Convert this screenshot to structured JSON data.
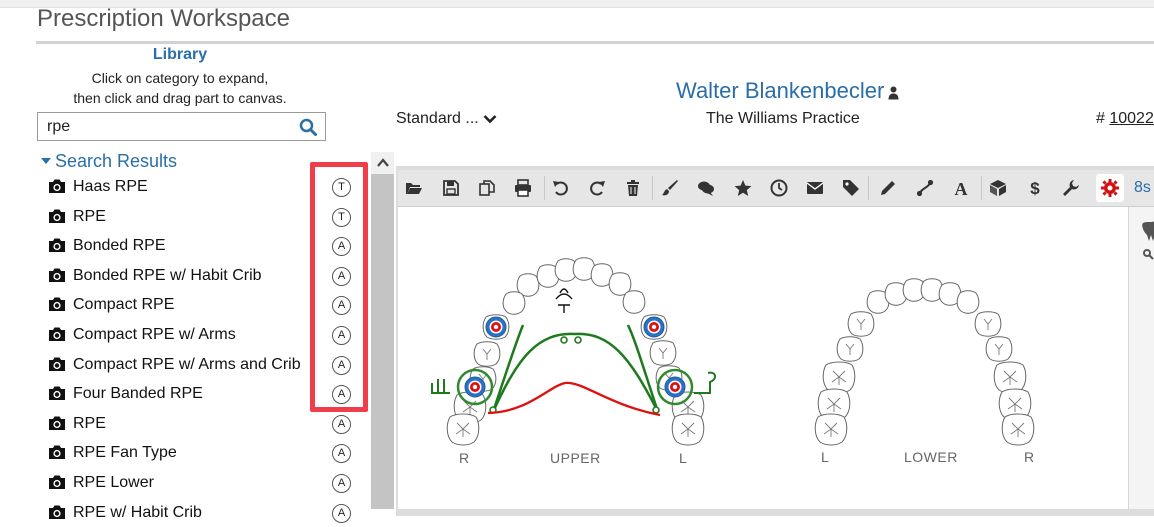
{
  "page": {
    "title": "Prescription Workspace"
  },
  "library": {
    "title": "Library",
    "help_line1": "Click on category to expand,",
    "help_line2": "then click and drag part to canvas."
  },
  "search": {
    "value": "rpe",
    "placeholder": ""
  },
  "results": {
    "heading": "Search Results",
    "items": [
      {
        "label": "Haas RPE",
        "badge": "T"
      },
      {
        "label": "RPE",
        "badge": "T"
      },
      {
        "label": "Bonded RPE",
        "badge": "A"
      },
      {
        "label": "Bonded RPE w/ Habit Crib",
        "badge": "A"
      },
      {
        "label": "Compact RPE",
        "badge": "A"
      },
      {
        "label": "Compact RPE w/ Arms",
        "badge": "A"
      },
      {
        "label": "Compact RPE w/ Arms and Crib",
        "badge": "A"
      },
      {
        "label": "Four Banded RPE",
        "badge": "A"
      },
      {
        "label": "RPE",
        "badge": "A"
      },
      {
        "label": "RPE Fan Type",
        "badge": "A"
      },
      {
        "label": "RPE Lower",
        "badge": "A"
      },
      {
        "label": "RPE w/ Habit Crib",
        "badge": "A"
      }
    ]
  },
  "patient": {
    "name": "Walter Blankenbecler",
    "template_select": "Standard ...",
    "practice": "The Williams Practice",
    "rx_prefix": "#",
    "rx_number": "10022"
  },
  "toolbar": {
    "icons": [
      "open-folder-icon",
      "save-icon",
      "copy-icon",
      "print-icon",
      "undo-icon",
      "redo-icon",
      "trash-icon",
      "brush-icon",
      "comments-icon",
      "star-icon",
      "clock-icon",
      "envelope-icon",
      "tag-icon",
      "pencil-icon",
      "wire-icon",
      "font-icon",
      "cube-icon",
      "dollar-icon",
      "wrench-icon",
      "gear-icon"
    ],
    "active_icon": "gear-icon",
    "overflow_label": "8s"
  },
  "canvas": {
    "upper": {
      "label": "UPPER",
      "right": "R",
      "left": "L"
    },
    "lower": {
      "label": "LOWER",
      "left": "L",
      "right": "R"
    }
  },
  "colors": {
    "link_blue": "#2a6ea8",
    "highlight_red": "#f03d4a",
    "appliance_green": "#1d7a1d",
    "appliance_red": "#e01010",
    "band_blue": "#2a73c4"
  }
}
